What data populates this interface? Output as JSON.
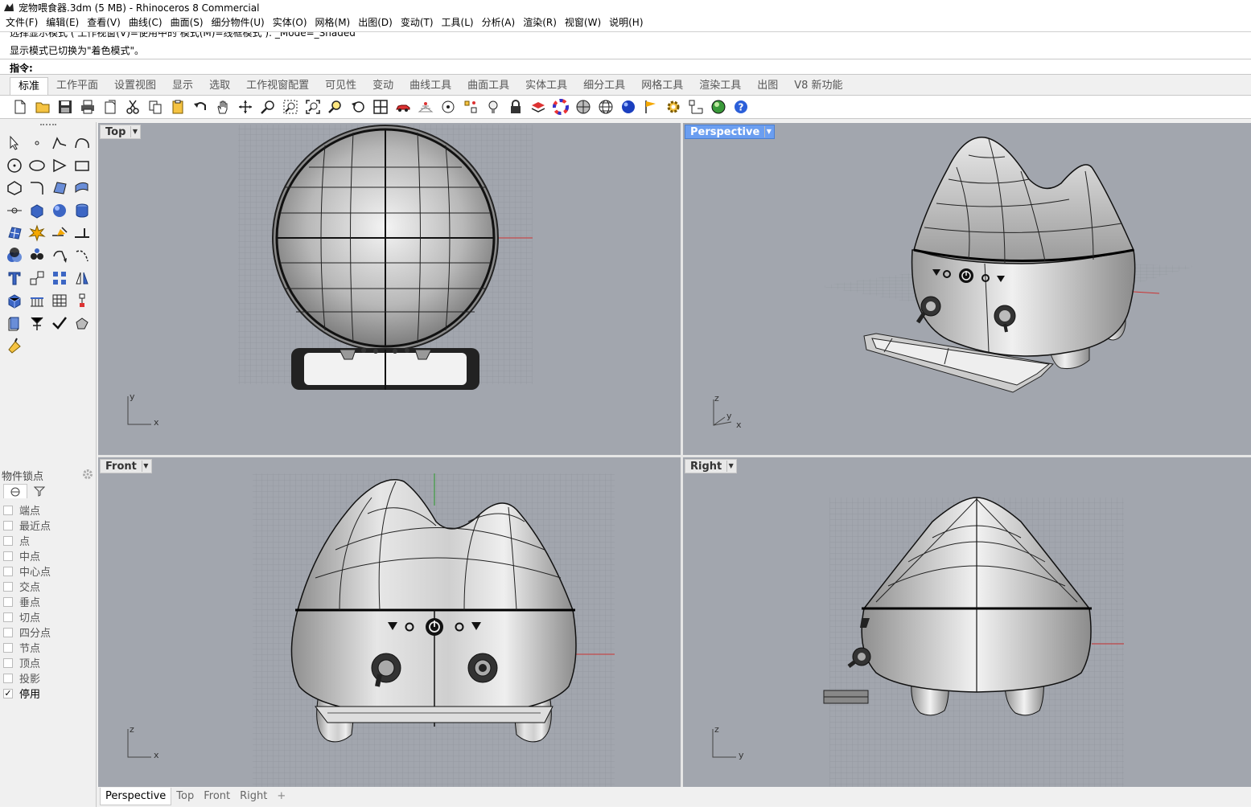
{
  "window": {
    "title": "宠物喂食器.3dm (5 MB) - Rhinoceros 8 Commercial"
  },
  "menu": [
    "文件(F)",
    "编辑(E)",
    "查看(V)",
    "曲线(C)",
    "曲面(S)",
    "细分物件(U)",
    "实体(O)",
    "网格(M)",
    "出图(D)",
    "变动(T)",
    "工具(L)",
    "分析(A)",
    "渲染(R)",
    "视窗(W)",
    "说明(H)"
  ],
  "command": {
    "history_cut": "选择显示模式 ( 工作视窗(V)=使用中的 模式(M)=线框模式 ): _Mode=_Shaded",
    "history_last": "显示模式已切换为\"着色模式\"。",
    "prompt_label": "指令:",
    "input_value": ""
  },
  "toolbar_tabs": [
    "标准",
    "工作平面",
    "设置视图",
    "显示",
    "选取",
    "工作视窗配置",
    "可见性",
    "变动",
    "曲线工具",
    "曲面工具",
    "实体工具",
    "细分工具",
    "网格工具",
    "渲染工具",
    "出图",
    "V8 新功能"
  ],
  "toolbar_tabs_active": 0,
  "toolbar_icons": [
    "new-file-icon",
    "open-folder-icon",
    "save-icon",
    "print-icon",
    "import-icon",
    "cut-icon",
    "copy-icon",
    "paste-icon",
    "undo-icon",
    "pan-hand-icon",
    "rotate-view-icon",
    "zoom-dynamic-icon",
    "zoom-window-icon",
    "zoom-extents-icon",
    "zoom-selected-icon",
    "undo-view-icon",
    "viewport-layout-icon",
    "car-render-icon",
    "grid-snap-icon",
    "cplane-icon",
    "points-icon",
    "light-bulb-icon",
    "lock-icon",
    "layer-icon",
    "color-wheel-icon",
    "shade-sphere-icon",
    "wire-sphere-icon",
    "render-sphere-icon",
    "flag-icon",
    "settings-gear-icon",
    "dimension-icon",
    "globe-icon",
    "help-icon"
  ],
  "osnap": {
    "header": "物件锁点",
    "items": [
      {
        "label": "端点",
        "checked": false
      },
      {
        "label": "最近点",
        "checked": false
      },
      {
        "label": "点",
        "checked": false
      },
      {
        "label": "中点",
        "checked": false
      },
      {
        "label": "中心点",
        "checked": false
      },
      {
        "label": "交点",
        "checked": false
      },
      {
        "label": "垂点",
        "checked": false
      },
      {
        "label": "切点",
        "checked": false
      },
      {
        "label": "四分点",
        "checked": false
      },
      {
        "label": "节点",
        "checked": false
      },
      {
        "label": "顶点",
        "checked": false
      },
      {
        "label": "投影",
        "checked": false
      },
      {
        "label": "停用",
        "checked": true
      }
    ]
  },
  "viewports": {
    "top": {
      "label": "Top",
      "axis_a": "y",
      "axis_b": "x"
    },
    "perspective": {
      "label": "Perspective",
      "axis_z": "z",
      "axis_y": "y",
      "axis_x": "x"
    },
    "front": {
      "label": "Front",
      "axis_a": "z",
      "axis_b": "x"
    },
    "right": {
      "label": "Right",
      "axis_a": "z",
      "axis_b": "y"
    }
  },
  "bottom_tabs": [
    "Perspective",
    "Top",
    "Front",
    "Right"
  ],
  "bottom_tab_active": 0,
  "bottom_add": "+"
}
